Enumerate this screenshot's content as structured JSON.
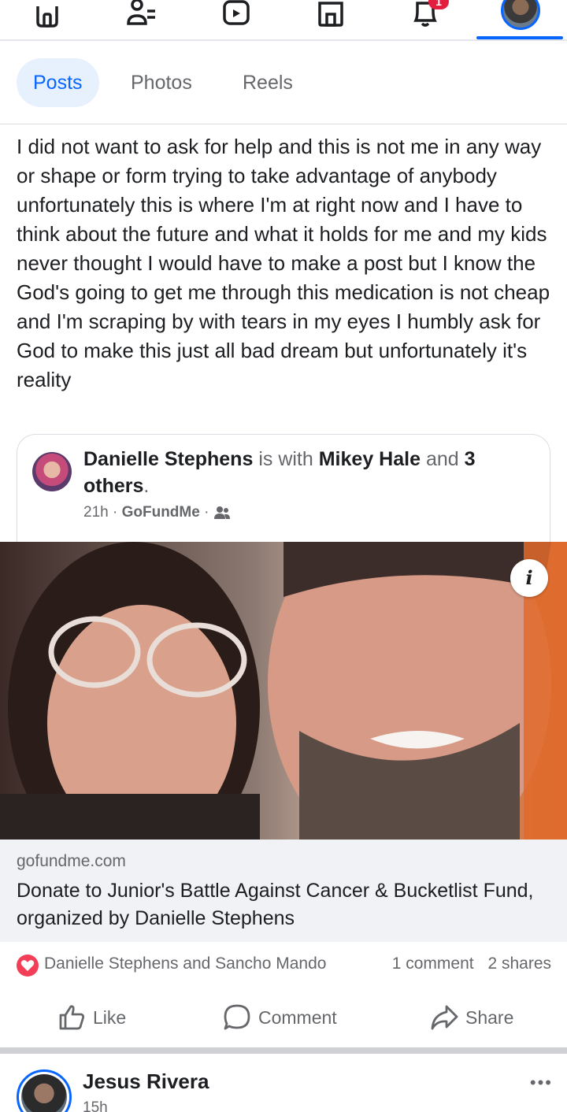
{
  "nav": {
    "items": [
      "home-icon",
      "friends-icon",
      "video-icon",
      "marketplace-icon",
      "notifications-icon",
      "profile-icon"
    ],
    "notification_badge": "1",
    "accent_color": "#0866ff"
  },
  "tabs": [
    {
      "label": "Posts",
      "active": true
    },
    {
      "label": "Photos",
      "active": false
    },
    {
      "label": "Reels",
      "active": false
    }
  ],
  "post": {
    "text": "I did not want to ask for help and this is not me in any way or shape or form trying to take advantage of anybody unfortunately this is where I'm at right now and I have to think about the future and what it holds for me and my kids never thought I would have to make a post but I know the God's going to get me through this medication is not cheap and I'm scraping by with tears in my eyes I humbly ask for God to make this just all bad dream but unfortunately it's reality",
    "shared": {
      "author": "Danielle Stephens",
      "with_text": "is with",
      "tagged": "Mikey Hale",
      "and_text": "and",
      "others": "3 others",
      "period": ".",
      "time": "21h",
      "separator": "·",
      "via": "GoFundMe"
    },
    "photo_info_icon": "i",
    "link": {
      "domain": "gofundme.com",
      "title": "Donate to Junior's Battle Against Cancer & Bucketlist Fund, organized by Danielle Stephens"
    },
    "reactors": "Danielle Stephens and Sancho Mando",
    "comments": "1 comment",
    "shares": "2 shares",
    "actions": {
      "like": "Like",
      "comment": "Comment",
      "share": "Share"
    }
  },
  "next_post": {
    "author": "Jesus Rivera",
    "time": "15h",
    "more": "•••"
  }
}
